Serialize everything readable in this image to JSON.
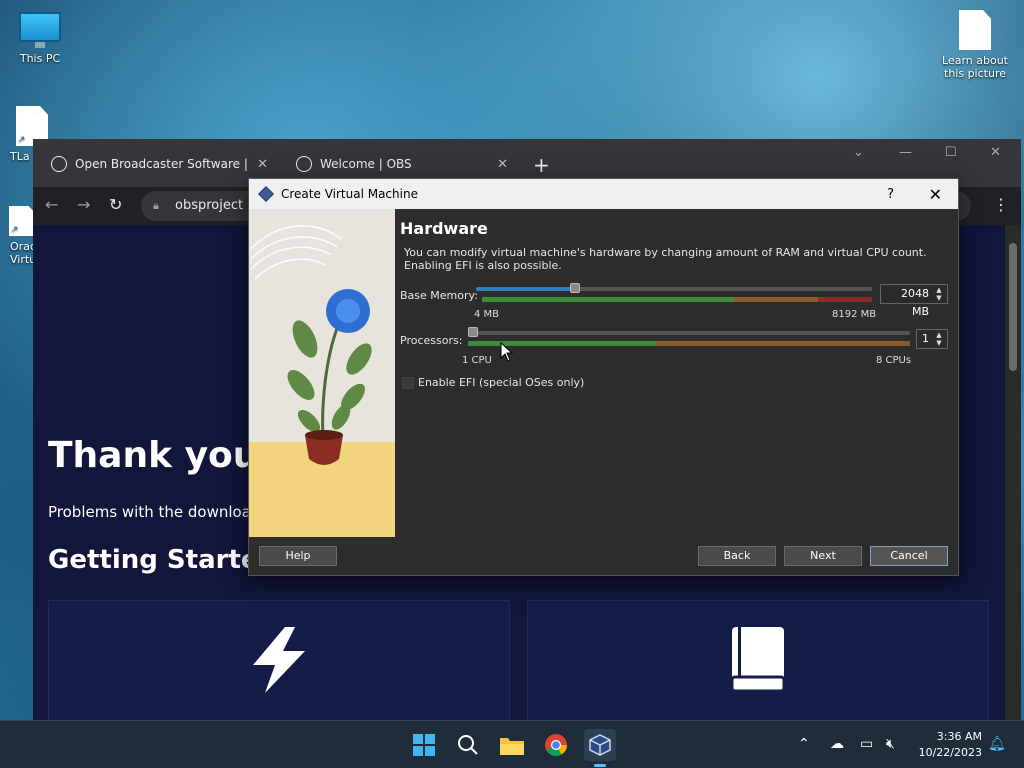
{
  "desktop": {
    "icons": [
      {
        "label": "This PC"
      },
      {
        "label": "TLa"
      },
      {
        "label": "Orac Virtu"
      },
      {
        "label": "Learn about this picture"
      }
    ]
  },
  "browser": {
    "tabs": [
      {
        "title": "Open Broadcaster Software | OB",
        "close": "✕"
      },
      {
        "title": "Welcome | OBS",
        "close": "✕"
      }
    ],
    "new_tab": "+",
    "url": "obsproject",
    "page": {
      "heading": "Thank you",
      "subtext": "Problems with the downloa",
      "section_heading": "Getting Starte"
    }
  },
  "dialog": {
    "title": "Create Virtual Machine",
    "help_glyph": "?",
    "close_glyph": "✕",
    "heading": "Hardware",
    "description_line1": "You can modify virtual machine's hardware by changing amount of RAM and virtual CPU count.",
    "description_line2": "Enabling EFI is also possible.",
    "memory": {
      "label": "Base Memory:",
      "value": "2048 MB",
      "min_label": "4 MB",
      "max_label": "8192 MB",
      "fraction": 0.25
    },
    "processors": {
      "label": "Processors:",
      "value": "1",
      "min_label": "1 CPU",
      "max_label": "8 CPUs",
      "fraction": 0.0
    },
    "efi_label": "Enable EFI (special OSes only)",
    "buttons": {
      "help": "Help",
      "back": "Back",
      "next": "Next",
      "cancel": "Cancel"
    }
  },
  "taskbar": {
    "time": "3:36 AM",
    "date": "10/22/2023"
  }
}
